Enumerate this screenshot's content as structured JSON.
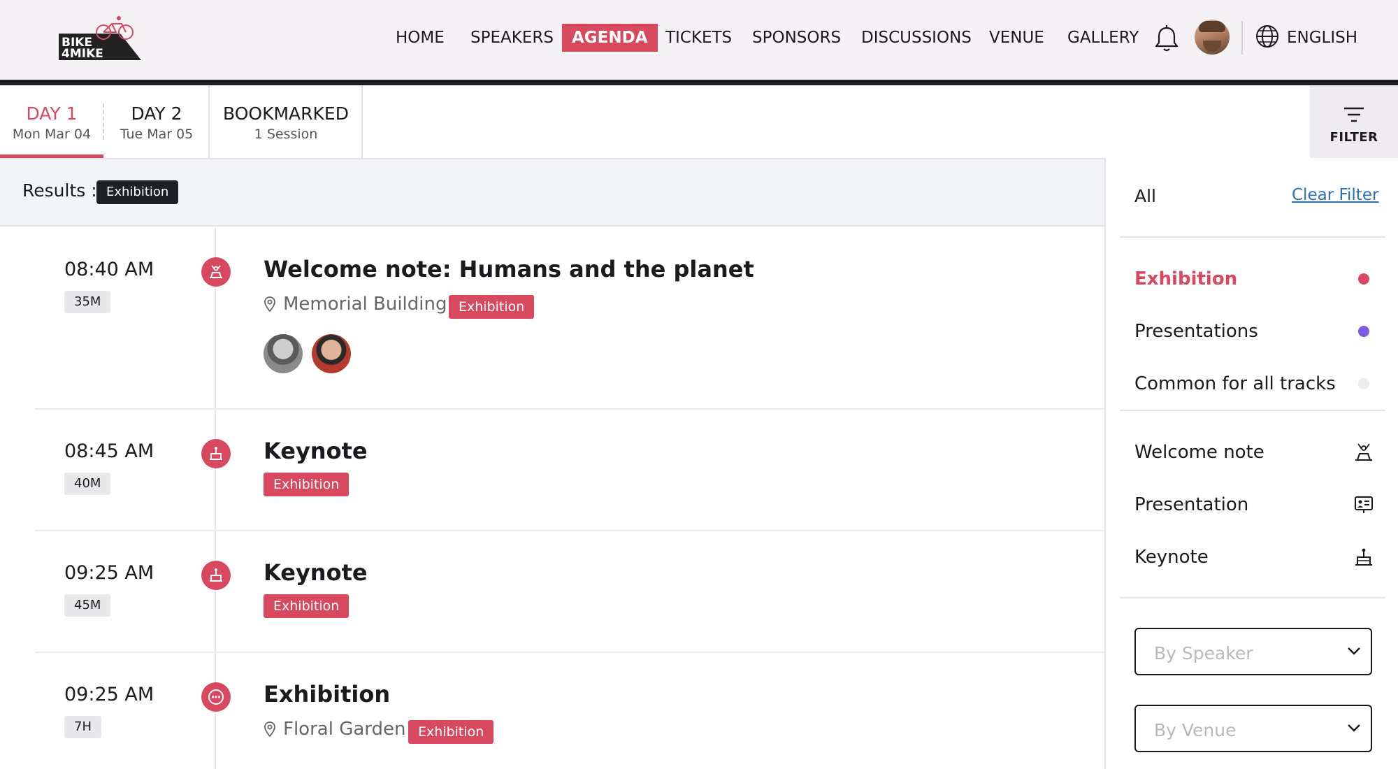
{
  "brand": {
    "line1": "BIKE",
    "line2": "4MIKE",
    "color": "#d8485f"
  },
  "nav": {
    "items": [
      {
        "label": "HOME"
      },
      {
        "label": "SPEAKERS"
      },
      {
        "label": "AGENDA",
        "active": true
      },
      {
        "label": "TICKETS"
      },
      {
        "label": "SPONSORS"
      },
      {
        "label": "DISCUSSIONS"
      },
      {
        "label": "VENUE"
      },
      {
        "label": "GALLERY"
      }
    ],
    "language": "ENGLISH",
    "icons": [
      "bell-icon",
      "avatar",
      "globe-icon"
    ]
  },
  "tabs": [
    {
      "label": "DAY 1",
      "sub": "Mon Mar 04",
      "active": true
    },
    {
      "label": "DAY 2",
      "sub": "Tue Mar 05"
    },
    {
      "label": "BOOKMARKED",
      "sub": "1 Session"
    }
  ],
  "filter_button": {
    "label": "FILTER",
    "icon": "filter-icon"
  },
  "results": {
    "label": "Results :",
    "chip": "Exhibition"
  },
  "sessions": [
    {
      "time": "08:40 AM",
      "duration": "35M",
      "icon": "welcome-note-icon",
      "title": "Welcome note: Humans and the planet",
      "location": "Memorial Building",
      "tag": "Exhibition",
      "speakers": [
        "speaker-avatar",
        "speaker-avatar"
      ]
    },
    {
      "time": "08:45 AM",
      "duration": "40M",
      "icon": "keynote-icon",
      "title": "Keynote",
      "tag": "Exhibition"
    },
    {
      "time": "09:25 AM",
      "duration": "45M",
      "icon": "keynote-icon",
      "title": "Keynote",
      "tag": "Exhibition"
    },
    {
      "time": "09:25 AM",
      "duration": "7H",
      "icon": "more-icon",
      "title": "Exhibition",
      "location": "Floral Garden",
      "tag": "Exhibition"
    }
  ],
  "filter_panel": {
    "all_label": "All",
    "clear_label": "Clear Filter",
    "tracks": [
      {
        "label": "Exhibition",
        "color": "#d8485f",
        "active": true
      },
      {
        "label": "Presentations",
        "color": "#7b5ce0"
      },
      {
        "label": "Common for all tracks",
        "color": "#ecebf0"
      }
    ],
    "types": [
      {
        "label": "Welcome note",
        "icon": "welcome-note-icon"
      },
      {
        "label": "Presentation",
        "icon": "presentation-icon"
      },
      {
        "label": "Keynote",
        "icon": "keynote-icon"
      }
    ],
    "speaker_placeholder": "By Speaker",
    "venue_placeholder": "By Venue"
  }
}
